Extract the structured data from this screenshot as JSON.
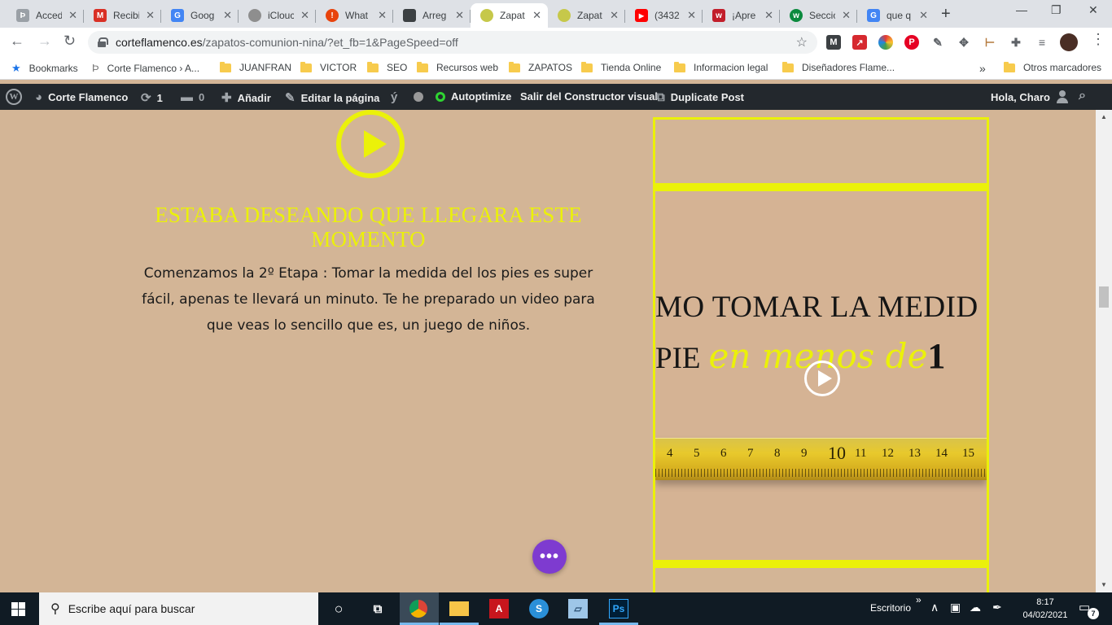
{
  "browser": {
    "tabs": [
      {
        "label": "Acced",
        "favicon_color": "#9aa0a6",
        "favicon_glyph": "Þ",
        "active": false
      },
      {
        "label": "Recibi",
        "favicon_color": "#d93025",
        "favicon_glyph": "M",
        "active": false
      },
      {
        "label": "Goog",
        "favicon_color": "#4285f4",
        "favicon_glyph": "G",
        "active": false
      },
      {
        "label": "iClouc",
        "favicon_color": "#8e8e8e",
        "favicon_glyph": "",
        "active": false
      },
      {
        "label": "What",
        "favicon_color": "#e8430c",
        "favicon_glyph": "!",
        "active": false
      },
      {
        "label": "Arreg",
        "favicon_color": "#3c4043",
        "favicon_glyph": "",
        "active": false
      },
      {
        "label": "Zapat",
        "favicon_color": "#c6c84a",
        "favicon_glyph": "",
        "active": true
      },
      {
        "label": "Zapat",
        "favicon_color": "#c6c84a",
        "favicon_glyph": "",
        "active": false
      },
      {
        "label": "(3432",
        "favicon_color": "#ff0000",
        "favicon_glyph": "▶",
        "active": false
      },
      {
        "label": "¡Apre",
        "favicon_color": "#c21e2b",
        "favicon_glyph": "w",
        "active": false
      },
      {
        "label": "Seccio",
        "favicon_color": "#0b8a3e",
        "favicon_glyph": "w",
        "active": false
      },
      {
        "label": "que q",
        "favicon_color": "#4285f4",
        "favicon_glyph": "G",
        "active": false
      }
    ],
    "url": {
      "host": "corteflamenco.es",
      "path": "/zapatos-comunion-nina/?et_fb=1&PageSpeed=off"
    },
    "bookmarks": [
      {
        "label": "Bookmarks",
        "kind": "star-icon"
      },
      {
        "label": "Corte Flamenco › A...",
        "kind": "page-icon"
      },
      {
        "label": "JUANFRAN",
        "kind": "folder-icon"
      },
      {
        "label": "VICTOR",
        "kind": "folder-icon"
      },
      {
        "label": "SEO",
        "kind": "folder-icon"
      },
      {
        "label": "Recursos web",
        "kind": "folder-icon"
      },
      {
        "label": "ZAPATOS",
        "kind": "folder-icon"
      },
      {
        "label": "Tienda Online",
        "kind": "folder-icon"
      },
      {
        "label": "Informacion legal",
        "kind": "folder-icon"
      },
      {
        "label": "Diseñadores Flame...",
        "kind": "folder-icon"
      }
    ],
    "bookmarks_overflow": "»",
    "other_bookmarks": "Otros marcadores"
  },
  "wp_admin_bar": {
    "site_name": "Corte Flamenco",
    "updates_count": "1",
    "comments_count": "0",
    "add_new": "Añadir",
    "edit_page": "Editar la página",
    "autoptimize": "Autoptimize",
    "exit_builder": "Salir del Constructor visual",
    "duplicate_post": "Duplicate Post",
    "greeting": "Hola, Charo"
  },
  "content": {
    "headline": "ESTABA DESEANDO QUE LLEGARA ESTE MOMENTO",
    "body": "Comenzamos la 2º Etapa : Tomar la medida  del los pies es super fácil, apenas te llevará un minuto. Te he preparado un video para que veas lo sencillo que es, un juego de niños.",
    "video": {
      "line1": "MO TOMAR LA MEDID",
      "line2_prefix": "PIE",
      "line2_script": "en menos de",
      "line2_number": "1",
      "tape_numbers": [
        "4",
        "5",
        "6",
        "7",
        "8",
        "9",
        "10",
        "11",
        "12",
        "13",
        "14",
        "15"
      ]
    },
    "fab_label": "•••"
  },
  "taskbar": {
    "search_placeholder": "Escribe aquí para buscar",
    "desktop_label": "Escritorio",
    "time": "8:17",
    "date": "04/02/2021",
    "notification_count": "7"
  },
  "colors": {
    "accent_yellow": "#ebf109",
    "page_background": "#d3b596",
    "wp_bar": "#23282d",
    "fab_purple": "#7e3bd0"
  }
}
